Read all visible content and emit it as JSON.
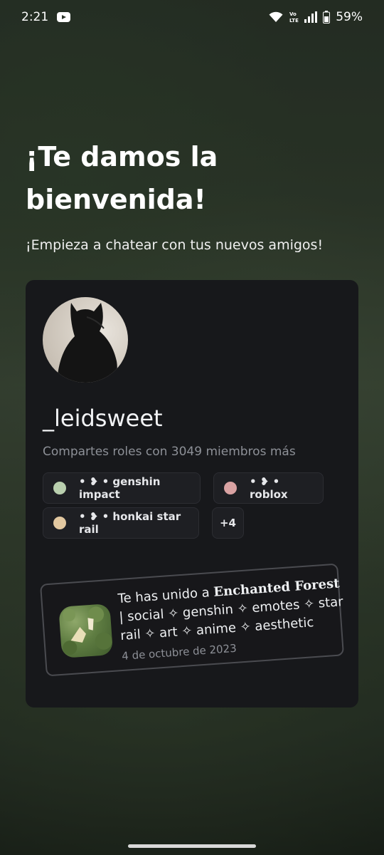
{
  "status_bar": {
    "time": "2:21",
    "battery": "59%",
    "icons": [
      "youtube-icon",
      "wifi-icon",
      "volte-icon",
      "signal-icon",
      "battery-icon"
    ]
  },
  "welcome": {
    "title": "¡Te damos la bienvenida!",
    "subtitle": "¡Empieza a chatear con tus nuevos amigos!"
  },
  "profile": {
    "username": "_leidsweet",
    "shared_roles_text": "Compartes roles con 3049 miembros más",
    "roles": [
      {
        "label": "• ❥ • genshin impact",
        "color": "#b9cfae"
      },
      {
        "label": "• ❥ • roblox",
        "color": "#d9a2a2"
      },
      {
        "label": "• ❥ • honkai star rail",
        "color": "#e2c8a0"
      }
    ],
    "more_roles": "+4"
  },
  "joined": {
    "prefix": "Te has unido a ",
    "server_name": "Enchanted Forest",
    "suffix": " | social ✧ genshin ✧ emotes ✧ star rail ✧ art ✧ anime ✧ aesthetic",
    "date": "4 de octubre de 2023"
  }
}
